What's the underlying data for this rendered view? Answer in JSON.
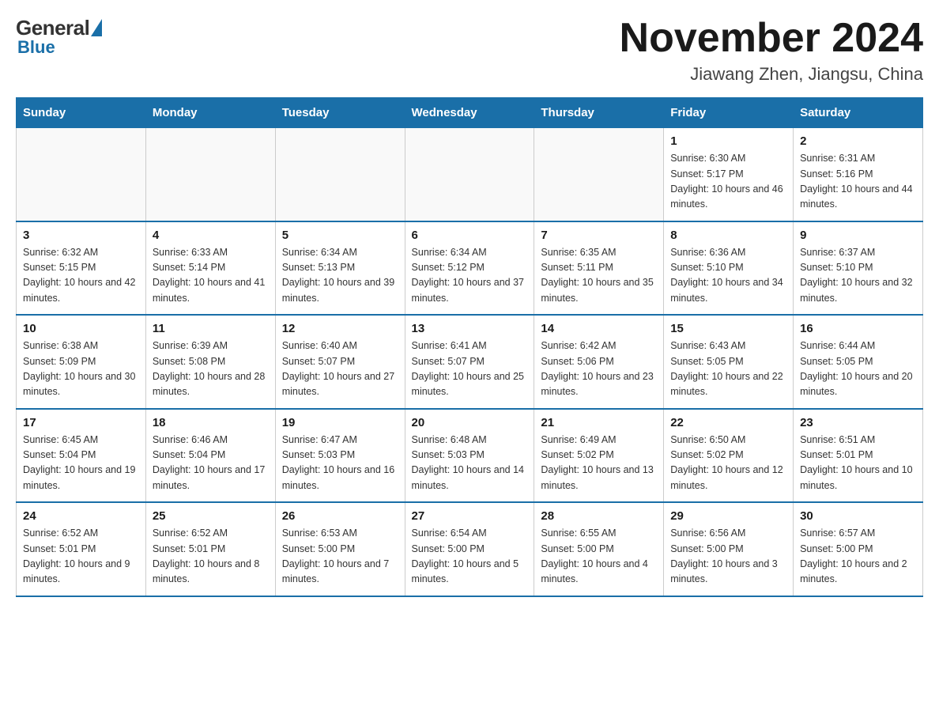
{
  "header": {
    "logo": {
      "general": "General",
      "blue": "Blue"
    },
    "title": "November 2024",
    "subtitle": "Jiawang Zhen, Jiangsu, China"
  },
  "weekdays": [
    "Sunday",
    "Monday",
    "Tuesday",
    "Wednesday",
    "Thursday",
    "Friday",
    "Saturday"
  ],
  "weeks": [
    [
      {
        "day": "",
        "info": ""
      },
      {
        "day": "",
        "info": ""
      },
      {
        "day": "",
        "info": ""
      },
      {
        "day": "",
        "info": ""
      },
      {
        "day": "",
        "info": ""
      },
      {
        "day": "1",
        "info": "Sunrise: 6:30 AM\nSunset: 5:17 PM\nDaylight: 10 hours and 46 minutes."
      },
      {
        "day": "2",
        "info": "Sunrise: 6:31 AM\nSunset: 5:16 PM\nDaylight: 10 hours and 44 minutes."
      }
    ],
    [
      {
        "day": "3",
        "info": "Sunrise: 6:32 AM\nSunset: 5:15 PM\nDaylight: 10 hours and 42 minutes."
      },
      {
        "day": "4",
        "info": "Sunrise: 6:33 AM\nSunset: 5:14 PM\nDaylight: 10 hours and 41 minutes."
      },
      {
        "day": "5",
        "info": "Sunrise: 6:34 AM\nSunset: 5:13 PM\nDaylight: 10 hours and 39 minutes."
      },
      {
        "day": "6",
        "info": "Sunrise: 6:34 AM\nSunset: 5:12 PM\nDaylight: 10 hours and 37 minutes."
      },
      {
        "day": "7",
        "info": "Sunrise: 6:35 AM\nSunset: 5:11 PM\nDaylight: 10 hours and 35 minutes."
      },
      {
        "day": "8",
        "info": "Sunrise: 6:36 AM\nSunset: 5:10 PM\nDaylight: 10 hours and 34 minutes."
      },
      {
        "day": "9",
        "info": "Sunrise: 6:37 AM\nSunset: 5:10 PM\nDaylight: 10 hours and 32 minutes."
      }
    ],
    [
      {
        "day": "10",
        "info": "Sunrise: 6:38 AM\nSunset: 5:09 PM\nDaylight: 10 hours and 30 minutes."
      },
      {
        "day": "11",
        "info": "Sunrise: 6:39 AM\nSunset: 5:08 PM\nDaylight: 10 hours and 28 minutes."
      },
      {
        "day": "12",
        "info": "Sunrise: 6:40 AM\nSunset: 5:07 PM\nDaylight: 10 hours and 27 minutes."
      },
      {
        "day": "13",
        "info": "Sunrise: 6:41 AM\nSunset: 5:07 PM\nDaylight: 10 hours and 25 minutes."
      },
      {
        "day": "14",
        "info": "Sunrise: 6:42 AM\nSunset: 5:06 PM\nDaylight: 10 hours and 23 minutes."
      },
      {
        "day": "15",
        "info": "Sunrise: 6:43 AM\nSunset: 5:05 PM\nDaylight: 10 hours and 22 minutes."
      },
      {
        "day": "16",
        "info": "Sunrise: 6:44 AM\nSunset: 5:05 PM\nDaylight: 10 hours and 20 minutes."
      }
    ],
    [
      {
        "day": "17",
        "info": "Sunrise: 6:45 AM\nSunset: 5:04 PM\nDaylight: 10 hours and 19 minutes."
      },
      {
        "day": "18",
        "info": "Sunrise: 6:46 AM\nSunset: 5:04 PM\nDaylight: 10 hours and 17 minutes."
      },
      {
        "day": "19",
        "info": "Sunrise: 6:47 AM\nSunset: 5:03 PM\nDaylight: 10 hours and 16 minutes."
      },
      {
        "day": "20",
        "info": "Sunrise: 6:48 AM\nSunset: 5:03 PM\nDaylight: 10 hours and 14 minutes."
      },
      {
        "day": "21",
        "info": "Sunrise: 6:49 AM\nSunset: 5:02 PM\nDaylight: 10 hours and 13 minutes."
      },
      {
        "day": "22",
        "info": "Sunrise: 6:50 AM\nSunset: 5:02 PM\nDaylight: 10 hours and 12 minutes."
      },
      {
        "day": "23",
        "info": "Sunrise: 6:51 AM\nSunset: 5:01 PM\nDaylight: 10 hours and 10 minutes."
      }
    ],
    [
      {
        "day": "24",
        "info": "Sunrise: 6:52 AM\nSunset: 5:01 PM\nDaylight: 10 hours and 9 minutes."
      },
      {
        "day": "25",
        "info": "Sunrise: 6:52 AM\nSunset: 5:01 PM\nDaylight: 10 hours and 8 minutes."
      },
      {
        "day": "26",
        "info": "Sunrise: 6:53 AM\nSunset: 5:00 PM\nDaylight: 10 hours and 7 minutes."
      },
      {
        "day": "27",
        "info": "Sunrise: 6:54 AM\nSunset: 5:00 PM\nDaylight: 10 hours and 5 minutes."
      },
      {
        "day": "28",
        "info": "Sunrise: 6:55 AM\nSunset: 5:00 PM\nDaylight: 10 hours and 4 minutes."
      },
      {
        "day": "29",
        "info": "Sunrise: 6:56 AM\nSunset: 5:00 PM\nDaylight: 10 hours and 3 minutes."
      },
      {
        "day": "30",
        "info": "Sunrise: 6:57 AM\nSunset: 5:00 PM\nDaylight: 10 hours and 2 minutes."
      }
    ]
  ]
}
